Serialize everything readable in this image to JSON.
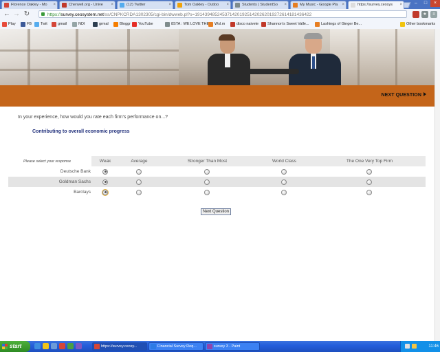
{
  "browser": {
    "tabs": [
      {
        "label": "Florence Oakley - Mo",
        "color": "#d44638"
      },
      {
        "label": "Cherwell.org - Unive",
        "color": "#c0392b"
      },
      {
        "label": "(12) Twitter",
        "color": "#55acee"
      },
      {
        "label": "Tom Oakley - Outloo",
        "color": "#f0a30a"
      },
      {
        "label": "Students | StudentSo",
        "color": "#7f8c8d"
      },
      {
        "label": "My Music - Google Pla",
        "color": "#e67e22"
      },
      {
        "label": "https://survey.ceosys",
        "color": "#dddddd",
        "active": true
      }
    ],
    "url": {
      "scheme": "https://",
      "host": "survey.ceosystem.net",
      "path": "/ss/CNPKCRDA1302305/cgi-bin/dwweb.pl?s=19143948524537142019251420262019272614181436422"
    },
    "bookmarks": [
      {
        "label": "Play",
        "color": "#e74c3c"
      },
      {
        "label": "FB",
        "color": "#3b5998"
      },
      {
        "label": "Twit",
        "color": "#55acee"
      },
      {
        "label": "gmail",
        "color": "#d44638"
      },
      {
        "label": "NDI",
        "color": "#95a5a6"
      },
      {
        "label": "grmal",
        "color": "#2c3e50"
      },
      {
        "label": "Bloggr",
        "color": "#f57d00"
      },
      {
        "label": "YouTube",
        "color": "#e52d27"
      },
      {
        "label": "8STA : WE LOVE THE ...",
        "color": "#7f8c8d"
      },
      {
        "label": "Wsl.m",
        "color": "#e67e22"
      },
      {
        "label": "disco naivete",
        "color": "#c0392b"
      },
      {
        "label": "Shannon's Sweet Valle...",
        "color": "#c0392b"
      },
      {
        "label": "Lashings of Ginger Be...",
        "color": "#e67e22"
      },
      {
        "label": "Other bookmarks",
        "color": "#f1c40f"
      }
    ]
  },
  "survey": {
    "next_top": "NEXT QUESTION",
    "question": "In your experience, how would you rate each firm's performance on...?",
    "subquestion": "Contributing to overall economic progress",
    "corner_label": "Please select your response",
    "columns": [
      "Weak",
      "Average",
      "Stronger Than Most",
      "World Class",
      "The One Very Top Firm"
    ],
    "rows": [
      {
        "firm": "Deutsche Bank",
        "selected": 0
      },
      {
        "firm": "Goldman Sachs",
        "selected": 0
      },
      {
        "firm": "Barclays",
        "selected": 0
      }
    ],
    "next_button": "Next Question",
    "accent_color": "#c4651a"
  },
  "taskbar": {
    "start": "start",
    "tasks": [
      {
        "label": "https://survey.ceosy...",
        "color": "#d44638"
      },
      {
        "label": "Financial Survey Req...",
        "color": "#2c7be5"
      },
      {
        "label": "survey 3 - Paint",
        "color": "#8e44ad"
      }
    ],
    "clock": "11:46"
  }
}
